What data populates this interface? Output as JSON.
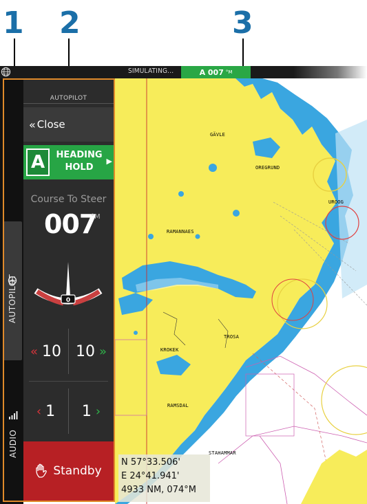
{
  "callouts": {
    "one": "1",
    "two": "2",
    "three": "3"
  },
  "status_bar": {
    "simulating": "SIMULATING...",
    "ap_mode": "A 007",
    "ap_unit": "°M",
    "globe_icon": "globe-icon"
  },
  "rail": {
    "autopilot_label": "AUTOPILOT",
    "autopilot_icon": "helm-icon",
    "audio_label": "AUDIO",
    "audio_icon": "signal-bars-icon"
  },
  "panel": {
    "title": "AUTOPILOT",
    "close_label": "Close",
    "mode_letter": "A",
    "mode_line1": "HEADING",
    "mode_line2": "HOLD",
    "course_label": "Course To Steer",
    "course_value": "007",
    "course_unit": "°M",
    "rudder_value": "0",
    "step_large_port": "10",
    "step_large_stbd": "10",
    "step_small_port": "1",
    "step_small_stbd": "1",
    "standby_label": "Standby"
  },
  "chart": {
    "places": [
      "GÄVLE",
      "OREGRUND",
      "RAMANNAES",
      "KROKEK",
      "TROSA",
      "RAMSDAL",
      "STAHAMMAR",
      "UROOG"
    ]
  },
  "position": {
    "lat": "N  57°33.506'",
    "lon": "E  24°41.941'",
    "range": "4933 NM, 074°M"
  },
  "colors": {
    "accent_green": "#2aa745",
    "standby_red": "#b72024",
    "frame_orange": "#e08a2a",
    "callout_blue": "#1b6fa8",
    "land_yellow": "#f7ec5a",
    "water_blue": "#3aa6e0"
  }
}
